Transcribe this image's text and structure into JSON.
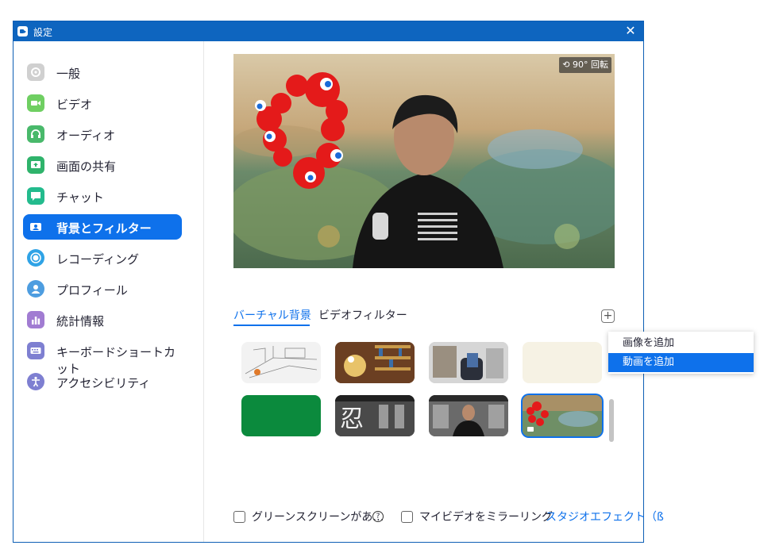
{
  "window": {
    "title": "設定",
    "close_glyph": "✕"
  },
  "sidebar": {
    "items": [
      {
        "label": "一般",
        "icon": "gear-icon",
        "color": "#d0d0d0",
        "active": false
      },
      {
        "label": "ビデオ",
        "icon": "video-icon",
        "color": "#6fcf62",
        "active": false
      },
      {
        "label": "オーディオ",
        "icon": "headphones-icon",
        "color": "#49b96b",
        "active": false
      },
      {
        "label": "画面の共有",
        "icon": "share-screen-icon",
        "color": "#2fb36b",
        "active": false
      },
      {
        "label": "チャット",
        "icon": "chat-icon",
        "color": "#23bb8d",
        "active": false
      },
      {
        "label": "背景とフィルター",
        "icon": "background-icon",
        "color": "#0e71eb",
        "active": true
      },
      {
        "label": "レコーディング",
        "icon": "record-icon",
        "color": "#2fa3e6",
        "active": false
      },
      {
        "label": "プロフィール",
        "icon": "profile-icon",
        "color": "#4d9de0",
        "active": false
      },
      {
        "label": "統計情報",
        "icon": "stats-icon",
        "color": "#a17cd2",
        "active": false
      },
      {
        "label": "キーボードショートカット",
        "icon": "keyboard-icon",
        "color": "#7e7fd1",
        "active": false
      },
      {
        "label": "アクセシビリティ",
        "icon": "accessibility-icon",
        "color": "#7e7fd1",
        "active": false
      }
    ]
  },
  "preview": {
    "rotate_label": "90° 回転"
  },
  "tabs": {
    "virtual_background": "バーチャル背景",
    "video_filter": "ビデオフィルター"
  },
  "add_button": "+",
  "bottom": {
    "green_screen": "グリーンスクリーンがあ…",
    "help": "?",
    "mirror": "マイビデオをミラーリング",
    "studio_effect": "スタジオエフェクト（ß"
  },
  "menu": {
    "add_image": "画像を追加",
    "add_video": "動画を追加"
  },
  "colors": {
    "accent": "#0e71eb",
    "titlebar": "#0e65bf",
    "green_bg": "#0b8a3d",
    "cream_bg": "#f6f2e4"
  }
}
